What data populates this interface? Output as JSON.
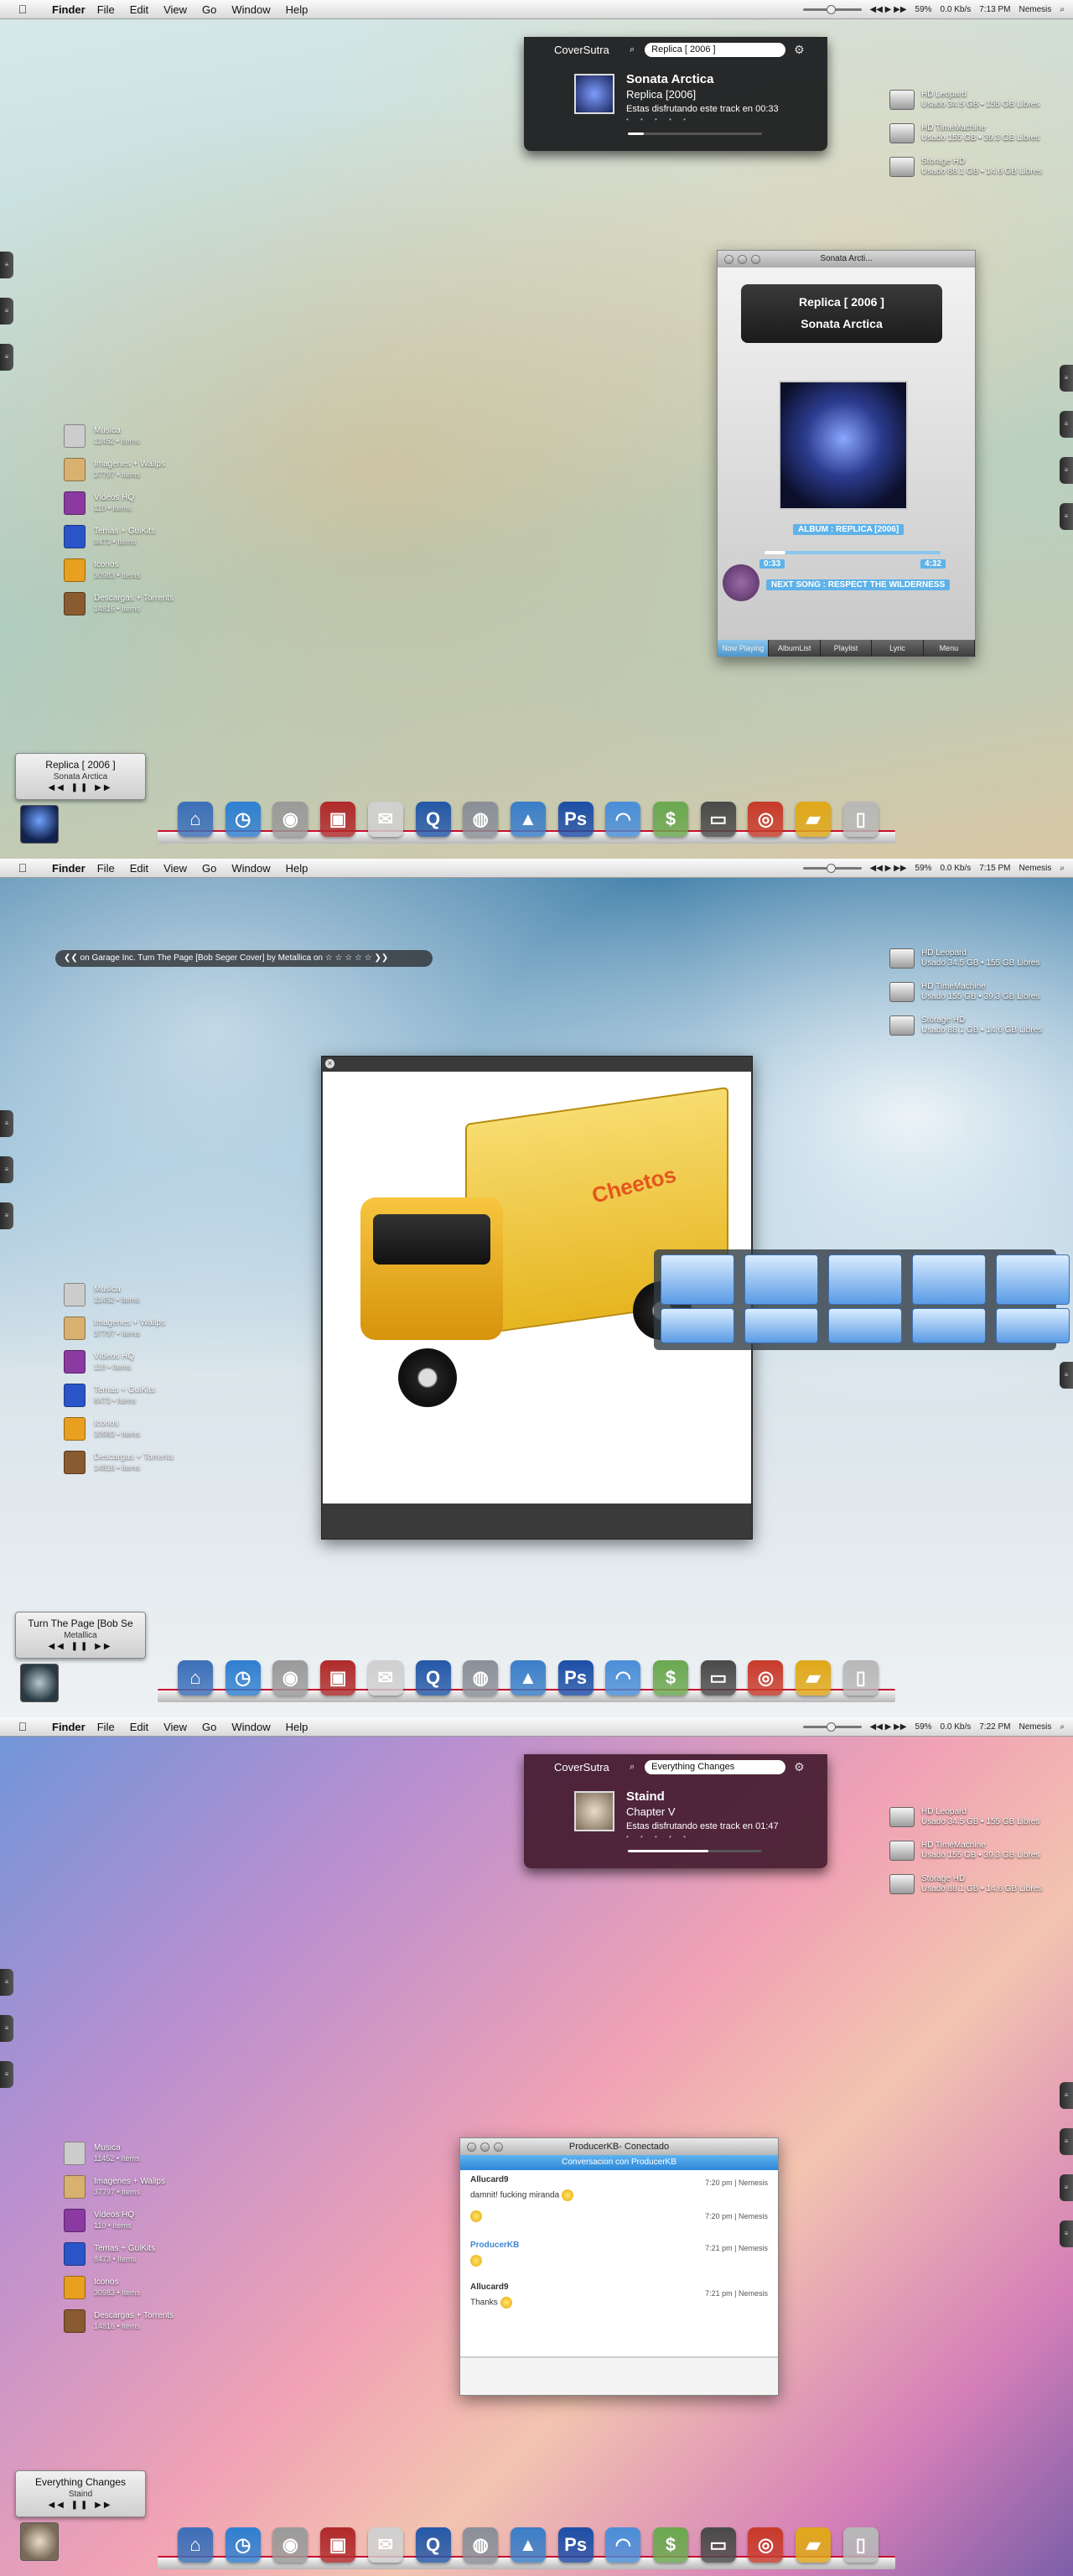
{
  "menubar": {
    "app": "Finder",
    "menus": [
      "File",
      "Edit",
      "View",
      "Go",
      "Window",
      "Help"
    ],
    "cpu": "59%",
    "net": "0.0 Kb/s",
    "user": "Nemesis"
  },
  "shot1": {
    "clock": "7:13 PM",
    "coversutra": {
      "title": "CoverSutra",
      "search": "Replica [ 2006 ]",
      "artist": "Sonata Arctica",
      "album": "Replica [2006]",
      "status": "Estas disfrutando este track en 00:33",
      "progress": 0.12
    },
    "player": {
      "title": "Sonata Arcti...",
      "line1": "Replica [ 2006 ]",
      "line2": "Sonata Arctica",
      "album": "ALBUM : REPLICA [2006]",
      "elapsed": "0:33",
      "total": "4:32",
      "next": "NEXT SONG : RESPECT THE WILDERNESS",
      "tabs": [
        "Now Playing",
        "AlbumList",
        "Playlist",
        "Lyric",
        "Menu"
      ],
      "progress": 0.12
    },
    "mini": {
      "title": "Replica [ 2006 ]",
      "artist": "Sonata Arctica",
      "controls": "◀◀ ❚❚ ▶▶"
    }
  },
  "shot2": {
    "clock": "7:15 PM",
    "lastfm": "❮❮ on Garage Inc.     Turn The Page [Bob Seger Cover] by Metallica on ☆ ☆ ☆ ☆ ☆ ❯❯",
    "mini": {
      "title": "Turn The Page [Bob Se",
      "artist": "Metallica",
      "controls": "◀◀ ❚❚ ▶▶"
    },
    "truck_text": "Cheetos"
  },
  "shot3": {
    "clock": "7:22 PM",
    "coversutra": {
      "title": "CoverSutra",
      "search": "Everything Changes",
      "artist": "Staind",
      "album": "Chapter V",
      "status": "Estas disfrutando este track en 01:47",
      "progress": 0.6
    },
    "chat": {
      "title": "ProducerKB- Conectado",
      "subtitle": "Conversacion con ProducerKB",
      "messages": [
        {
          "who": "Allucard9",
          "text": "damnit! fucking miranda",
          "time": "7:20 pm | Nemesis"
        },
        {
          "who": "",
          "text": "",
          "time": "7:20 pm | Nemesis"
        },
        {
          "who": "ProducerKB",
          "text": "",
          "time": "7:21 pm | Nemesis"
        },
        {
          "who": "Allucard9",
          "text": "Thanks",
          "time": "7:21 pm | Nemesis"
        }
      ]
    },
    "mini": {
      "title": "Everything Changes",
      "artist": "Staind",
      "controls": "◀◀ ❚❚ ▶▶"
    }
  },
  "drives": [
    {
      "name": "HD Leopard",
      "info": "Usado 34.5 GB  •  155 GB Libres"
    },
    {
      "name": "HD TimeMachine",
      "info": "Usado 155 GB  •  39.3 GB Libres"
    },
    {
      "name": "Storage HD",
      "info": "Usado 88.1 GB  •  14.6 GB Libres"
    }
  ],
  "folders": [
    {
      "name": "Musica",
      "count": "11452  •  Items",
      "color": "#cccccc"
    },
    {
      "name": "Imagenes + Wallps",
      "count": "37797  •  Items",
      "color": "#d8b070"
    },
    {
      "name": "Videos HQ",
      "count": "110  •  Items",
      "color": "#8a3aa0"
    },
    {
      "name": "Temas + GuiKits",
      "count": "8473  •  Items",
      "color": "#2a55c8"
    },
    {
      "name": "Iconos",
      "count": "30983  •  Items",
      "color": "#e8a020"
    },
    {
      "name": "Descargas + Torrents",
      "count": "14816  •  Items",
      "color": "#8a5a30"
    }
  ],
  "dock": [
    {
      "name": "home-icon",
      "color": "#3b6fb8",
      "glyph": "⌂"
    },
    {
      "name": "clock-icon",
      "color": "#2f7fd0",
      "glyph": "◷"
    },
    {
      "name": "disc-icon",
      "color": "#9a9a9a",
      "glyph": "◉"
    },
    {
      "name": "camera-icon",
      "color": "#b02a2a",
      "glyph": "▣"
    },
    {
      "name": "mail-icon",
      "color": "#d0d0d0",
      "glyph": "✉"
    },
    {
      "name": "quicktime-icon",
      "color": "#2458a8",
      "glyph": "Q"
    },
    {
      "name": "robot-icon",
      "color": "#8a8f98",
      "glyph": "◍"
    },
    {
      "name": "wizard-icon",
      "color": "#3a7ec8",
      "glyph": "▲"
    },
    {
      "name": "photoshop-icon",
      "color": "#1c4ea6",
      "glyph": "Ps"
    },
    {
      "name": "rainbow-icon",
      "color": "#4a8ed8",
      "glyph": "◠"
    },
    {
      "name": "money-icon",
      "color": "#6aa84f",
      "glyph": "$"
    },
    {
      "name": "tv-icon",
      "color": "#4a4a4a",
      "glyph": "▭"
    },
    {
      "name": "target-icon",
      "color": "#c83a2a",
      "glyph": "◎"
    },
    {
      "name": "truck-icon",
      "color": "#e0a818",
      "glyph": "▰"
    },
    {
      "name": "trash-icon",
      "color": "#b8b8b8",
      "glyph": "▯"
    }
  ]
}
